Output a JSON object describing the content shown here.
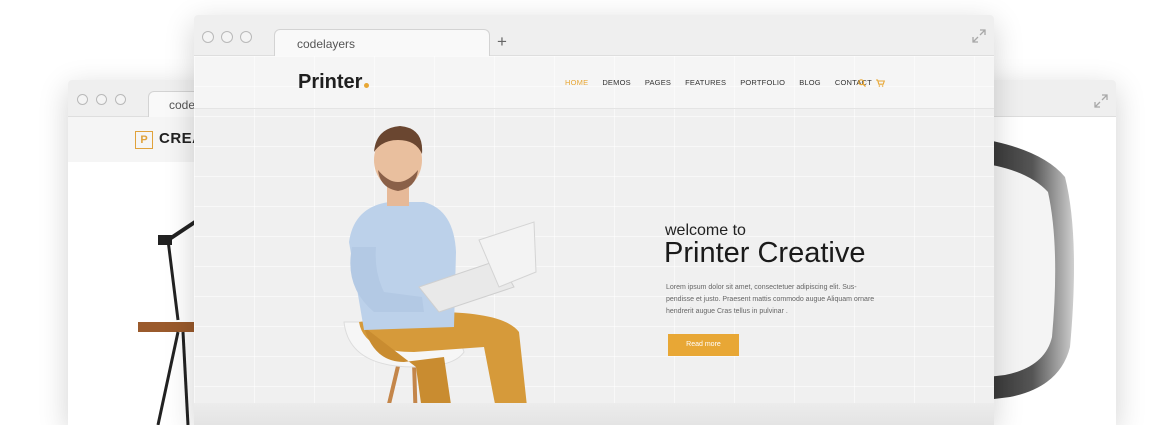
{
  "left_window": {
    "tab_text": "code",
    "logo_letter": "P",
    "brand_text": "CREA"
  },
  "front_window": {
    "tab_text": "codelayers",
    "new_tab_symbol": "+",
    "site": {
      "brand": "Printer",
      "nav": [
        "HOME",
        "DEMOS",
        "PAGES",
        "FEATURES",
        "PORTFOLIO",
        "BLOG",
        "CONTACT"
      ],
      "active_nav": "HOME",
      "hero": {
        "kicker": "welcome to",
        "title": "Printer Creative",
        "body": "Lorem ipsum dolor sit amet, consectetuer adipiscing elit. Sus-pendisse et justo. Praesent mattis commodo augue Aliquam ornare hendrerit augue Cras tellus in pulvinar .",
        "button": "Read more"
      }
    }
  },
  "colors": {
    "accent": "#e8a735"
  },
  "icons": [
    "search-icon",
    "cart-icon",
    "expand-icon",
    "plus-icon"
  ]
}
